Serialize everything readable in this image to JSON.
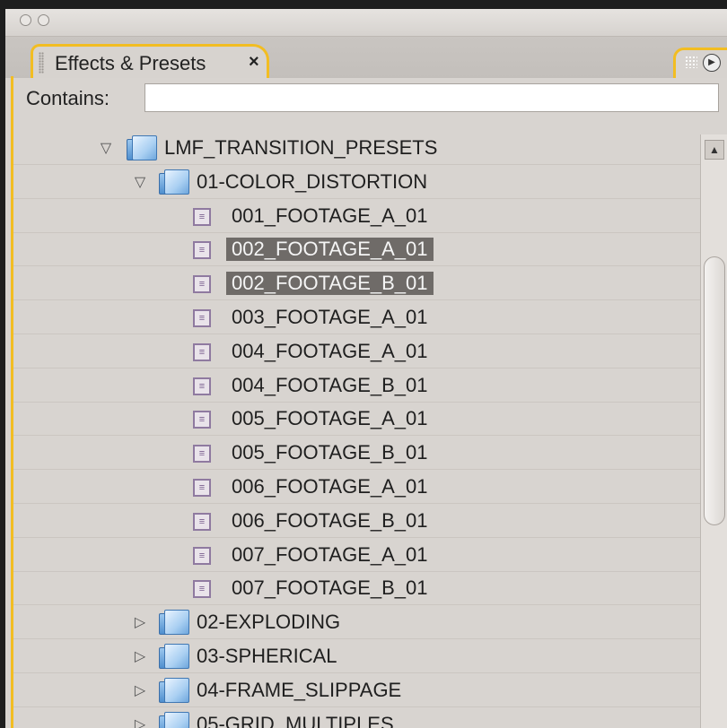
{
  "panel": {
    "tab_label": "Effects & Presets",
    "close_glyph": "×",
    "search_label": "Contains:",
    "search_value": "",
    "flyout_glyph": "▶"
  },
  "tree": [
    {
      "label": "LMF_TRANSITION_PRESETS",
      "type": "folder",
      "expanded": true,
      "level": 0,
      "selected": false
    },
    {
      "label": "01-COLOR_DISTORTION",
      "type": "folder",
      "expanded": true,
      "level": 1,
      "selected": false
    },
    {
      "label": "001_FOOTAGE_A_01",
      "type": "preset",
      "level": 2,
      "selected": false
    },
    {
      "label": "002_FOOTAGE_A_01",
      "type": "preset",
      "level": 2,
      "selected": true
    },
    {
      "label": "002_FOOTAGE_B_01",
      "type": "preset",
      "level": 2,
      "selected": true
    },
    {
      "label": "003_FOOTAGE_A_01",
      "type": "preset",
      "level": 2,
      "selected": false
    },
    {
      "label": "004_FOOTAGE_A_01",
      "type": "preset",
      "level": 2,
      "selected": false
    },
    {
      "label": "004_FOOTAGE_B_01",
      "type": "preset",
      "level": 2,
      "selected": false
    },
    {
      "label": "005_FOOTAGE_A_01",
      "type": "preset",
      "level": 2,
      "selected": false
    },
    {
      "label": "005_FOOTAGE_B_01",
      "type": "preset",
      "level": 2,
      "selected": false
    },
    {
      "label": "006_FOOTAGE_A_01",
      "type": "preset",
      "level": 2,
      "selected": false
    },
    {
      "label": "006_FOOTAGE_B_01",
      "type": "preset",
      "level": 2,
      "selected": false
    },
    {
      "label": "007_FOOTAGE_A_01",
      "type": "preset",
      "level": 2,
      "selected": false
    },
    {
      "label": "007_FOOTAGE_B_01",
      "type": "preset",
      "level": 2,
      "selected": false
    },
    {
      "label": "02-EXPLODING",
      "type": "folder",
      "expanded": false,
      "level": 1,
      "selected": false
    },
    {
      "label": "03-SPHERICAL",
      "type": "folder",
      "expanded": false,
      "level": 1,
      "selected": false
    },
    {
      "label": "04-FRAME_SLIPPAGE",
      "type": "folder",
      "expanded": false,
      "level": 1,
      "selected": false
    },
    {
      "label": "05-GRID_MULTIPLES",
      "type": "folder",
      "expanded": false,
      "level": 1,
      "selected": false
    }
  ],
  "colors": {
    "accent": "#f2bd22",
    "selection": "#6f6b68",
    "panel_bg": "#d8d4d0"
  },
  "icons": {
    "folder": "folder-icon",
    "preset": "preset-icon",
    "expanded": "disclosure-expanded-icon",
    "collapsed": "disclosure-collapsed-icon"
  }
}
